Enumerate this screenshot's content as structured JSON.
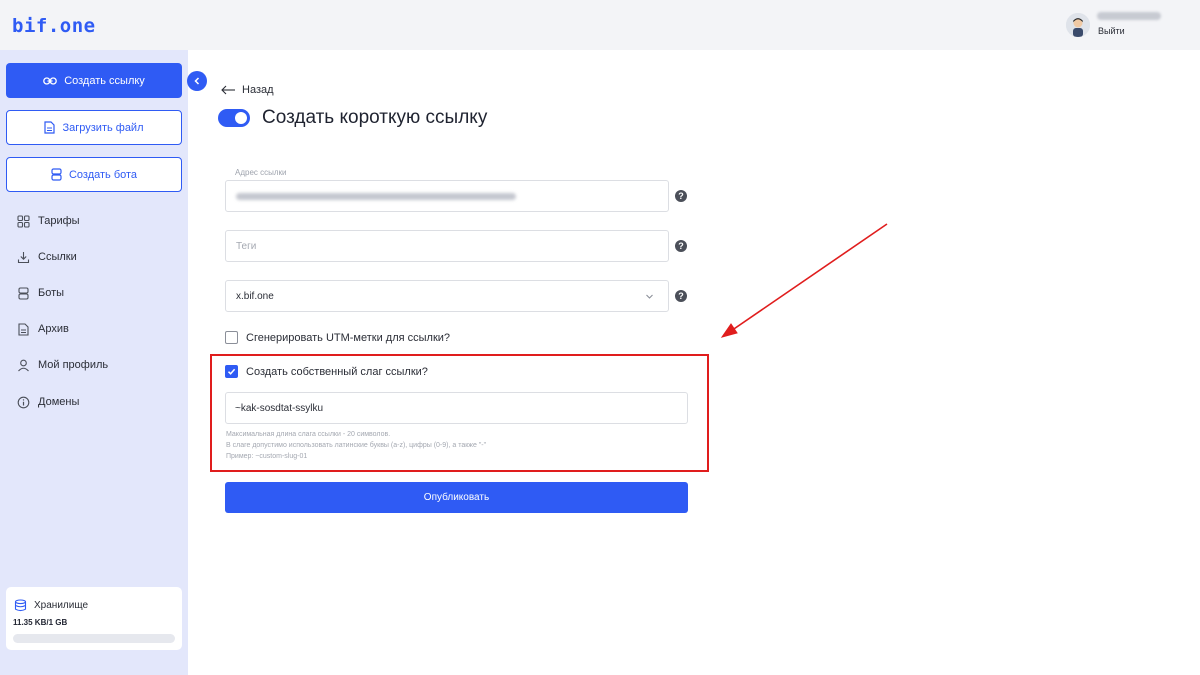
{
  "header": {
    "logo": "bif.one",
    "logout_label": "Выйти"
  },
  "sidebar": {
    "create_link_label": "Создать ссылку",
    "upload_file_label": "Загрузить файл",
    "create_bot_label": "Создать бота",
    "nav": [
      {
        "label": "Тарифы",
        "icon": "grid-icon"
      },
      {
        "label": "Ссылки",
        "icon": "link-download-icon"
      },
      {
        "label": "Боты",
        "icon": "bot-icon"
      },
      {
        "label": "Архив",
        "icon": "document-icon"
      },
      {
        "label": "Мой профиль",
        "icon": "user-icon"
      },
      {
        "label": "Домены",
        "icon": "info-icon"
      }
    ],
    "storage": {
      "title": "Хранилище",
      "value": "11.35 KB/1 GB",
      "used_fraction": 0.0
    }
  },
  "main": {
    "back_label": "Назад",
    "title": "Создать короткую ссылку",
    "url_field": {
      "label": "Адрес ссылки"
    },
    "tags_field": {
      "placeholder": "Теги"
    },
    "domain_select": {
      "value": "x.bif.one"
    },
    "utm_checkbox": {
      "label": "Сгенерировать UTM-метки для ссылки?",
      "checked": false
    },
    "slug_checkbox": {
      "label": "Создать собственный слаг ссылки?",
      "checked": true
    },
    "slug_input": {
      "value": "~kak-sosdtat-ssylku"
    },
    "slug_hints": [
      "Максимальная длина слага ссылки - 20 символов.",
      "В слаге допустимо использовать латинские буквы (a-z), цифры (0-9), а также \"-\"",
      "Пример: ~custom-slug-01"
    ],
    "publish_label": "Опубликовать"
  },
  "colors": {
    "accent": "#2f5bf4",
    "sidebar_bg": "#e3e7fb",
    "highlight": "#e01d1d"
  }
}
